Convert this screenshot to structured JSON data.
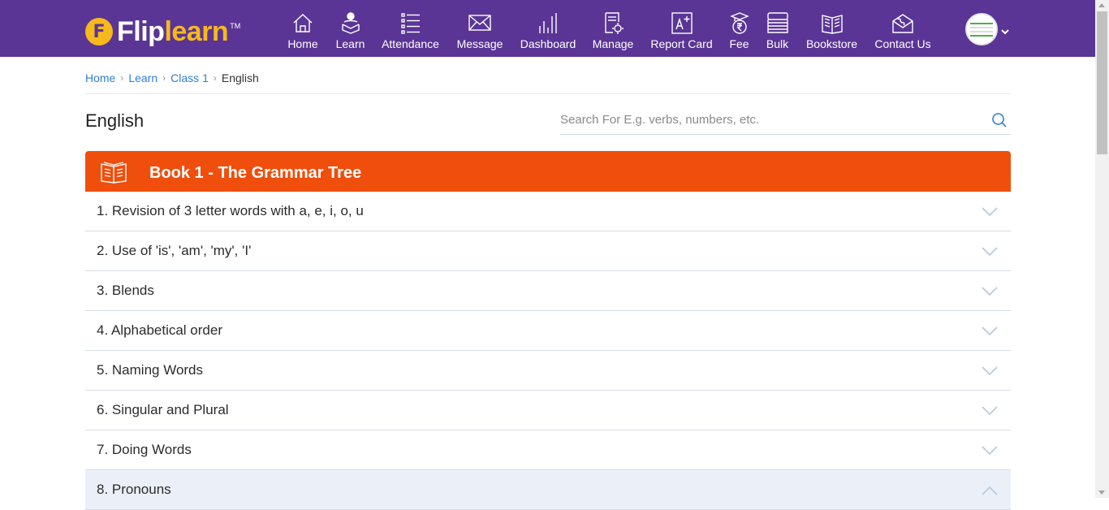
{
  "brand": {
    "mark": "F",
    "name_part1": "Flip",
    "name_part2": "learn",
    "tm": "TM"
  },
  "nav": [
    {
      "label": "Home",
      "icon": "home-icon"
    },
    {
      "label": "Learn",
      "icon": "learn-icon"
    },
    {
      "label": "Attendance",
      "icon": "attendance-icon"
    },
    {
      "label": "Message",
      "icon": "message-icon"
    },
    {
      "label": "Dashboard",
      "icon": "dashboard-icon"
    },
    {
      "label": "Manage",
      "icon": "manage-icon"
    },
    {
      "label": "Report Card",
      "icon": "report-card-icon"
    },
    {
      "label": "Fee",
      "icon": "fee-icon"
    },
    {
      "label": "Bulk",
      "icon": "bulk-icon"
    },
    {
      "label": "Bookstore",
      "icon": "bookstore-icon"
    },
    {
      "label": "Contact Us",
      "icon": "contact-icon"
    }
  ],
  "breadcrumb": [
    {
      "label": "Home"
    },
    {
      "label": "Learn"
    },
    {
      "label": "Class 1"
    },
    {
      "label": "English"
    }
  ],
  "page_title": "English",
  "search": {
    "placeholder": "Search For E.g. verbs, numbers, etc.",
    "value": ""
  },
  "book": {
    "title": "Book 1 - The Grammar Tree",
    "icon": "book-icon"
  },
  "chapters": [
    {
      "label": "1. Revision of 3 letter words with a, e, i, o, u",
      "expanded": false
    },
    {
      "label": "2. Use of 'is', 'am', 'my', 'I'",
      "expanded": false
    },
    {
      "label": "3. Blends",
      "expanded": false
    },
    {
      "label": "4. Alphabetical order",
      "expanded": false
    },
    {
      "label": "5. Naming Words",
      "expanded": false
    },
    {
      "label": "6. Singular and Plural",
      "expanded": false
    },
    {
      "label": "7. Doing Words",
      "expanded": false
    },
    {
      "label": "8. Pronouns",
      "expanded": true
    }
  ],
  "colors": {
    "header_bg": "#5a3595",
    "brand_yellow": "#f6b91b",
    "book_header_bg": "#ef4e0c",
    "link_blue": "#2f7fd4",
    "active_row_bg": "#ebf0f8"
  }
}
